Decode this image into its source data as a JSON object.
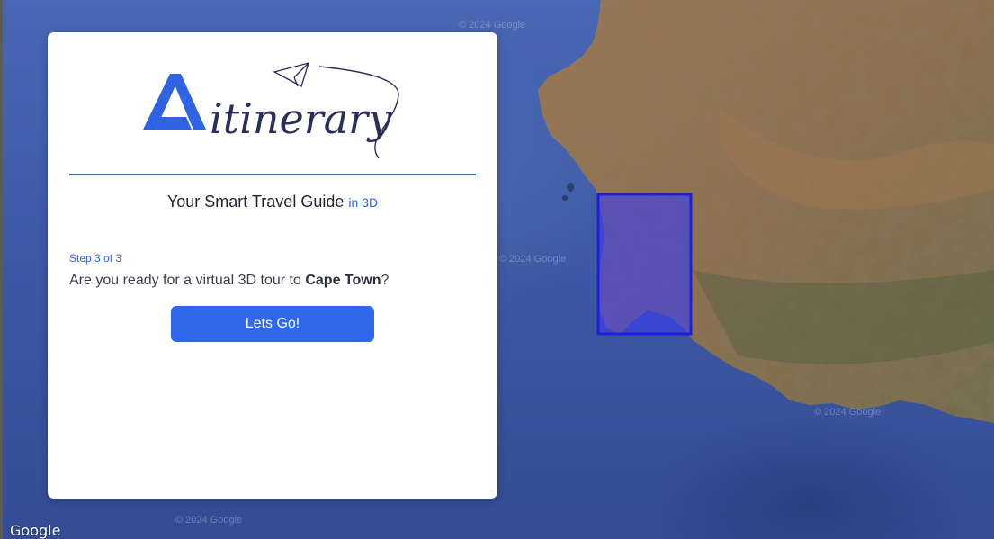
{
  "app": {
    "logo_text": "itinerary"
  },
  "header": {
    "tagline_main": "Your Smart Travel Guide",
    "tagline_accent": "in 3D"
  },
  "wizard": {
    "step_label": "Step 3 of 3",
    "question_prefix": "Are you ready for a virtual 3D tour to ",
    "destination": "Cape Town",
    "question_suffix": "?",
    "go_button_label": "Lets Go!"
  },
  "map": {
    "attribution_logo": "Google",
    "watermark": "© 2024 Google",
    "region_highlight": "Cape Town"
  },
  "colors": {
    "accent": "#2f63e4",
    "button": "#3068ec",
    "highlight_fill": "#3a3cf0",
    "highlight_border": "#2020d8",
    "ocean": "#3e5aa6",
    "land": "#8a6a4a"
  },
  "icons": [
    "paper-plane-icon",
    "logo-a-icon"
  ]
}
